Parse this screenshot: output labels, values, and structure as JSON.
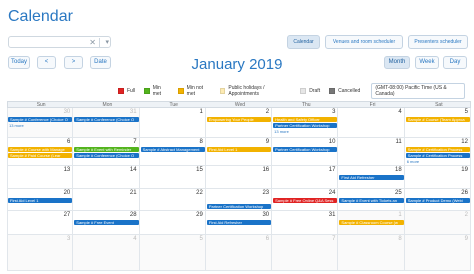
{
  "app": {
    "title": "Calendar"
  },
  "search": {
    "value": "",
    "placeholder": ""
  },
  "view_tabs": [
    "Calendar",
    "Venues and room scheduler",
    "Presenters scheduler"
  ],
  "nav": {
    "today": "Today",
    "prev": "<",
    "next": ">",
    "date": "Date"
  },
  "month_title": "January 2019",
  "view_modes": [
    "Month",
    "Week",
    "Day"
  ],
  "timezone": "(GMT-08:00) Pacific Time (US & Canada)",
  "legend": [
    {
      "label": "Full",
      "color": "#e02323"
    },
    {
      "label": "Min met",
      "color": "#53b41d"
    },
    {
      "label": "Min not met",
      "color": "#f2b200"
    },
    {
      "label": "Public holidays / Appointments",
      "color": "#fdebb3"
    },
    {
      "label": "Draft",
      "color": "#e6e6e6"
    },
    {
      "label": "Cancelled",
      "color": "#777777"
    }
  ],
  "weekdays": [
    "Sun",
    "Mon",
    "Tue",
    "Wed",
    "Thu",
    "Fri",
    "Sat"
  ],
  "weeks": [
    [
      "30",
      "31",
      "1",
      "2",
      "3",
      "4",
      "5"
    ],
    [
      "6",
      "7",
      "8",
      "9",
      "10",
      "11",
      "12"
    ],
    [
      "13",
      "14",
      "15",
      "16",
      "17",
      "18",
      "19"
    ],
    [
      "20",
      "21",
      "22",
      "23",
      "24",
      "25",
      "26"
    ],
    [
      "27",
      "28",
      "29",
      "30",
      "31",
      "1",
      "2"
    ],
    [
      "3",
      "4",
      "5",
      "6",
      "7",
      "8",
      "9"
    ]
  ],
  "events": [
    {
      "title": "Sample # Conference (Choice O",
      "color": "#1a73c8"
    },
    {
      "title": "Sample # Conference (Choice O",
      "color": "#1a73c8"
    },
    {
      "title": "Empowering Your People",
      "color": "#f2b200"
    },
    {
      "title": "Health and Safety Officer",
      "color": "#f2b200"
    },
    {
      "title": "Partner Certification Workshop",
      "color": "#1a73c8"
    },
    {
      "title": "Sample # Course (Team Approa",
      "color": "#f2b200"
    },
    {
      "title": "Sample # Course with Manage",
      "color": "#f2b200"
    },
    {
      "title": "Sample # Event with Reminder",
      "color": "#53b41d"
    },
    {
      "title": "Sample # Abstract Management",
      "color": "#1a73c8"
    },
    {
      "title": "First Aid Level 1",
      "color": "#f2b200"
    },
    {
      "title": "Partner Certification Workshop",
      "color": "#1a73c8"
    },
    {
      "title": "Sample # Certification Process",
      "color": "#f2b200"
    },
    {
      "title": "Sample # Certification Process",
      "color": "#1a73c8"
    },
    {
      "title": "Sample # Paid Course (Lear",
      "color": "#f2b200"
    },
    {
      "title": "Sample # Conference (Choice O",
      "color": "#1a73c8"
    },
    {
      "title": "First Aid Refresher",
      "color": "#1a73c8"
    },
    {
      "title": "First Aid Level 1",
      "color": "#1a73c8"
    },
    {
      "title": "Sample # Free Online Q&A Sess",
      "color": "#e02323"
    },
    {
      "title": "Sample # Event with Tickets an",
      "color": "#1a73c8"
    },
    {
      "title": "Sample # Product Demo (Webi",
      "color": "#1a73c8"
    },
    {
      "title": "Partner Certification Workshop",
      "color": "#1a73c8"
    },
    {
      "title": "Sample # Free Event",
      "color": "#1a73c8"
    },
    {
      "title": "First Aid Refresher",
      "color": "#1a73c8"
    },
    {
      "title": "Sample # Classroom Course (w",
      "color": "#f2b200"
    }
  ],
  "more_links": [
    "13 more",
    "13 more",
    "6 more"
  ]
}
